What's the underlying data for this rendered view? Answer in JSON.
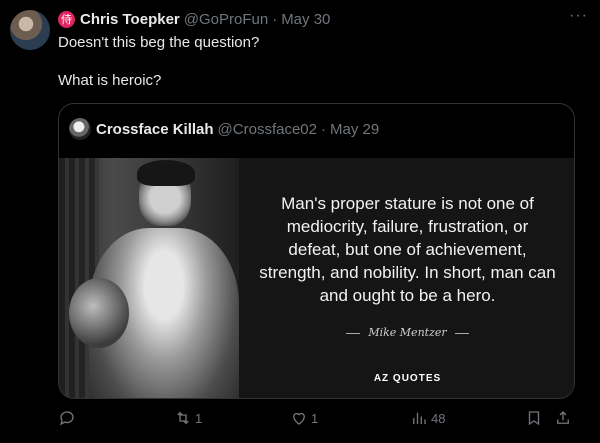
{
  "tweet": {
    "author_name": "Chris Toepker",
    "author_handle": "@GoProFun",
    "date": "May 30",
    "separator": "·",
    "badge_glyph": "侍",
    "more": "···",
    "lines": [
      "Doesn't this beg the question?",
      "What is heroic?"
    ]
  },
  "quoted": {
    "author_name": "Crossface Killah",
    "author_handle": "@Crossface02",
    "date": "May 29",
    "quote_text": "Man's proper stature is not one of mediocrity, failure, frustration, or defeat, but one of achievement, strength, and nobility. In short, man can and ought to be a hero.",
    "quote_author": "Mike Mentzer",
    "brand": "AZ QUOTES"
  },
  "actions": {
    "retweets": "1",
    "likes": "1",
    "views": "48"
  }
}
